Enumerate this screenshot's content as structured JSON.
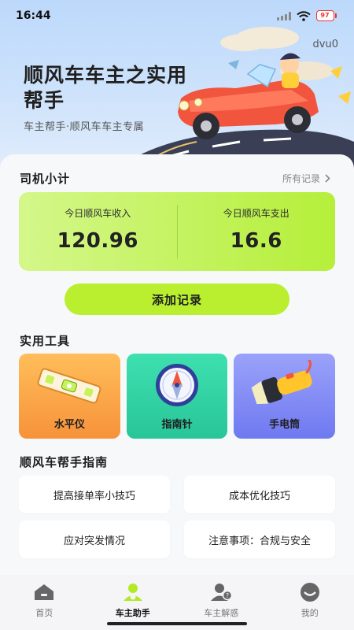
{
  "status_bar": {
    "time": "16:44",
    "battery": "97",
    "icons": [
      "signal-icon",
      "wifi-icon",
      "battery-icon"
    ]
  },
  "hero": {
    "title": "顺风车车主之实用帮手",
    "subtitle": "车主帮手·顺风车车主专属",
    "user_tag": "dvu0"
  },
  "driver_calc": {
    "heading": "司机小计",
    "all_records": "所有记录",
    "income_label": "今日顺风车收入",
    "income_value": "120.96",
    "expense_label": "今日顺风车支出",
    "expense_value": "16.6",
    "add_button": "添加记录"
  },
  "tools": {
    "heading": "实用工具",
    "items": [
      {
        "label": "水平仪",
        "icon": "level-icon",
        "color": "#f7923a"
      },
      {
        "label": "指南针",
        "icon": "compass-icon",
        "color": "#28c598"
      },
      {
        "label": "手电筒",
        "icon": "flashlight-icon",
        "color": "#6f79f0"
      }
    ]
  },
  "guide": {
    "heading": "顺风车帮手指南",
    "items": [
      {
        "label": "提高接单率小技巧"
      },
      {
        "label": "成本优化技巧"
      },
      {
        "label": "应对突发情况"
      },
      {
        "label": "注意事项：合规与安全"
      }
    ]
  },
  "tabbar": {
    "active": "车主助手",
    "items": [
      {
        "label": "首页",
        "icon": "home-icon"
      },
      {
        "label": "车主助手",
        "icon": "driver-icon"
      },
      {
        "label": "车主解惑",
        "icon": "faq-icon"
      },
      {
        "label": "我的",
        "icon": "profile-icon"
      }
    ]
  },
  "colors": {
    "accent_green": "#b9ef2f",
    "hero_bg": "#cfe3fb"
  }
}
